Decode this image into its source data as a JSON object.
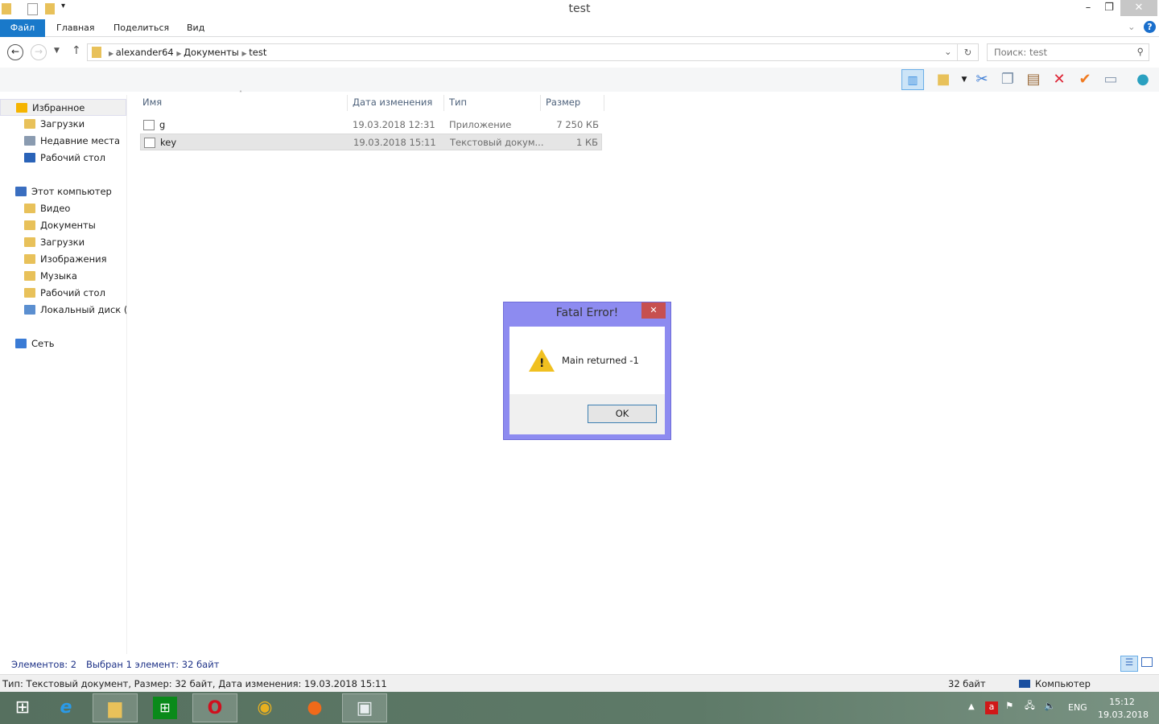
{
  "window": {
    "title": "test",
    "minimize": "–",
    "restore": "❐",
    "close": "✕"
  },
  "ribbon": {
    "tabs": [
      "Файл",
      "Главная",
      "Поделиться",
      "Вид"
    ],
    "help": "?"
  },
  "address": {
    "path": [
      "alexander64",
      "Документы",
      "test"
    ],
    "search_placeholder": "Поиск: test"
  },
  "nav": {
    "items": [
      {
        "label": "Избранное",
        "color": "#f5b400",
        "indent": 0
      },
      {
        "label": "Загрузки",
        "color": "#e8c15a",
        "indent": 1
      },
      {
        "label": "Недавние места",
        "color": "#8a9bb0",
        "indent": 1
      },
      {
        "label": "Рабочий стол",
        "color": "#2a63b8",
        "indent": 1
      },
      {
        "label": "Этот компьютер",
        "color": "#3a6ec0",
        "indent": 0,
        "gap": true
      },
      {
        "label": "Видео",
        "color": "#e8c15a",
        "indent": 1
      },
      {
        "label": "Документы",
        "color": "#e8c15a",
        "indent": 1
      },
      {
        "label": "Загрузки",
        "color": "#e8c15a",
        "indent": 1
      },
      {
        "label": "Изображения",
        "color": "#e8c15a",
        "indent": 1
      },
      {
        "label": "Музыка",
        "color": "#e8c15a",
        "indent": 1
      },
      {
        "label": "Рабочий стол",
        "color": "#e8c15a",
        "indent": 1
      },
      {
        "label": "Локальный диск (C",
        "color": "#5b8fd0",
        "indent": 1
      },
      {
        "label": "Сеть",
        "color": "#3a7bd5",
        "indent": 0,
        "gap": true
      }
    ]
  },
  "columns": [
    "Имя",
    "Дата изменения",
    "Тип",
    "Размер"
  ],
  "files": [
    {
      "name": "g",
      "date": "19.03.2018 12:31",
      "type": "Приложение",
      "size": "7 250 КБ"
    },
    {
      "name": "key",
      "date": "19.03.2018 15:11",
      "type": "Текстовый докум...",
      "size": "1 КБ"
    }
  ],
  "status": {
    "count": "Элементов: 2",
    "selected": "Выбран 1 элемент: 32 байт"
  },
  "details": {
    "text": "Тип: Текстовый документ, Размер: 32 байт, Дата изменения: 19.03.2018 15:11",
    "size": "32 байт",
    "location": "Компьютер"
  },
  "dialog": {
    "title": "Fatal Error!",
    "message": "Main returned -1",
    "ok": "OK",
    "close": "✕"
  },
  "tray": {
    "lang": "ENG",
    "time": "15:12",
    "date": "19.03.2018"
  }
}
